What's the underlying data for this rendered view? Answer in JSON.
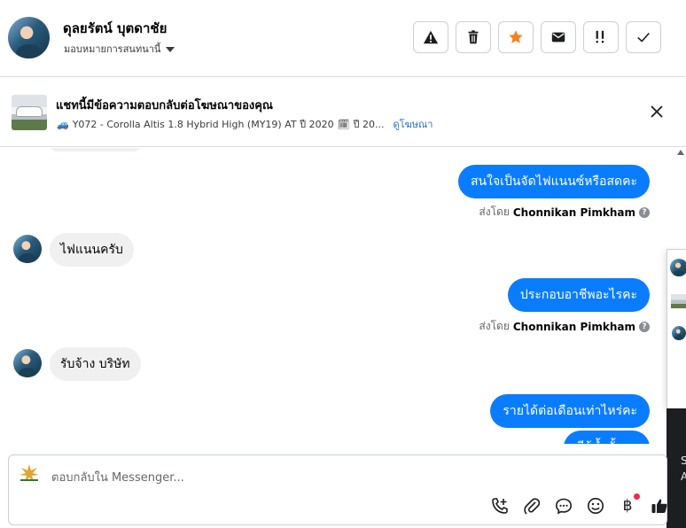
{
  "header": {
    "user_name": "ดุลยรัตน์ บุตดาชัย",
    "assign_label": "มอบหมายการสนทนานี้",
    "actions": [
      {
        "name": "report-spam-button",
        "icon": "warning-icon"
      },
      {
        "name": "delete-button",
        "icon": "trash-icon"
      },
      {
        "name": "star-button",
        "icon": "star-icon"
      },
      {
        "name": "mark-unread-button",
        "icon": "envelope-icon"
      },
      {
        "name": "follow-up-button",
        "icon": "exclamation-icon"
      },
      {
        "name": "mark-done-button",
        "icon": "checkmark-icon"
      }
    ]
  },
  "ad_banner": {
    "title": "แชทนี้มีข้อความตอบกลับต่อโฆษณาของคุณ",
    "car_icon": "🚙",
    "details": "Y072 - Corolla Altis 1.8 Hybrid High (MY19) AT ปี 2020",
    "calendar_icon": "🗓",
    "details2": "ปี 20...",
    "view_ad_link": "ดูโฆษณา"
  },
  "messages": [
    {
      "dir": "out",
      "text": "สนใจเป็นจัดไฟแนนซ์หรือสดคะ",
      "sent_by_prefix": "ส่งโดย",
      "sent_by_name": "Chonnikan Pimkham"
    },
    {
      "dir": "in",
      "text": "ไฟแนนครับ"
    },
    {
      "dir": "out",
      "text": "ประกอบอาชีพอะไรคะ",
      "sent_by_prefix": "ส่งโดย",
      "sent_by_name": "Chonnikan Pimkham"
    },
    {
      "dir": "in",
      "text": "รับจ้าง บริษัท"
    },
    {
      "dir": "out",
      "text": "รายได้ต่อเดือนเท่าไหร่คะ"
    },
    {
      "dir": "out",
      "text": "มีผู้ค้ำมั้ยคะ"
    }
  ],
  "side_panel": {
    "dark_text_1": "S",
    "dark_text_2": "A"
  },
  "composer": {
    "placeholder": "ตอบกลับใน Messenger...",
    "tools": [
      "call-add-icon",
      "paperclip-icon",
      "chat-bubble-icon",
      "emoji-icon",
      "baht-icon",
      "thumbs-up-icon"
    ],
    "baht_symbol": "฿"
  },
  "colors": {
    "accent_blue": "#0a7cff",
    "star_orange": "#f5821f",
    "link_blue": "#216fdb",
    "notification_red": "#f02849"
  }
}
